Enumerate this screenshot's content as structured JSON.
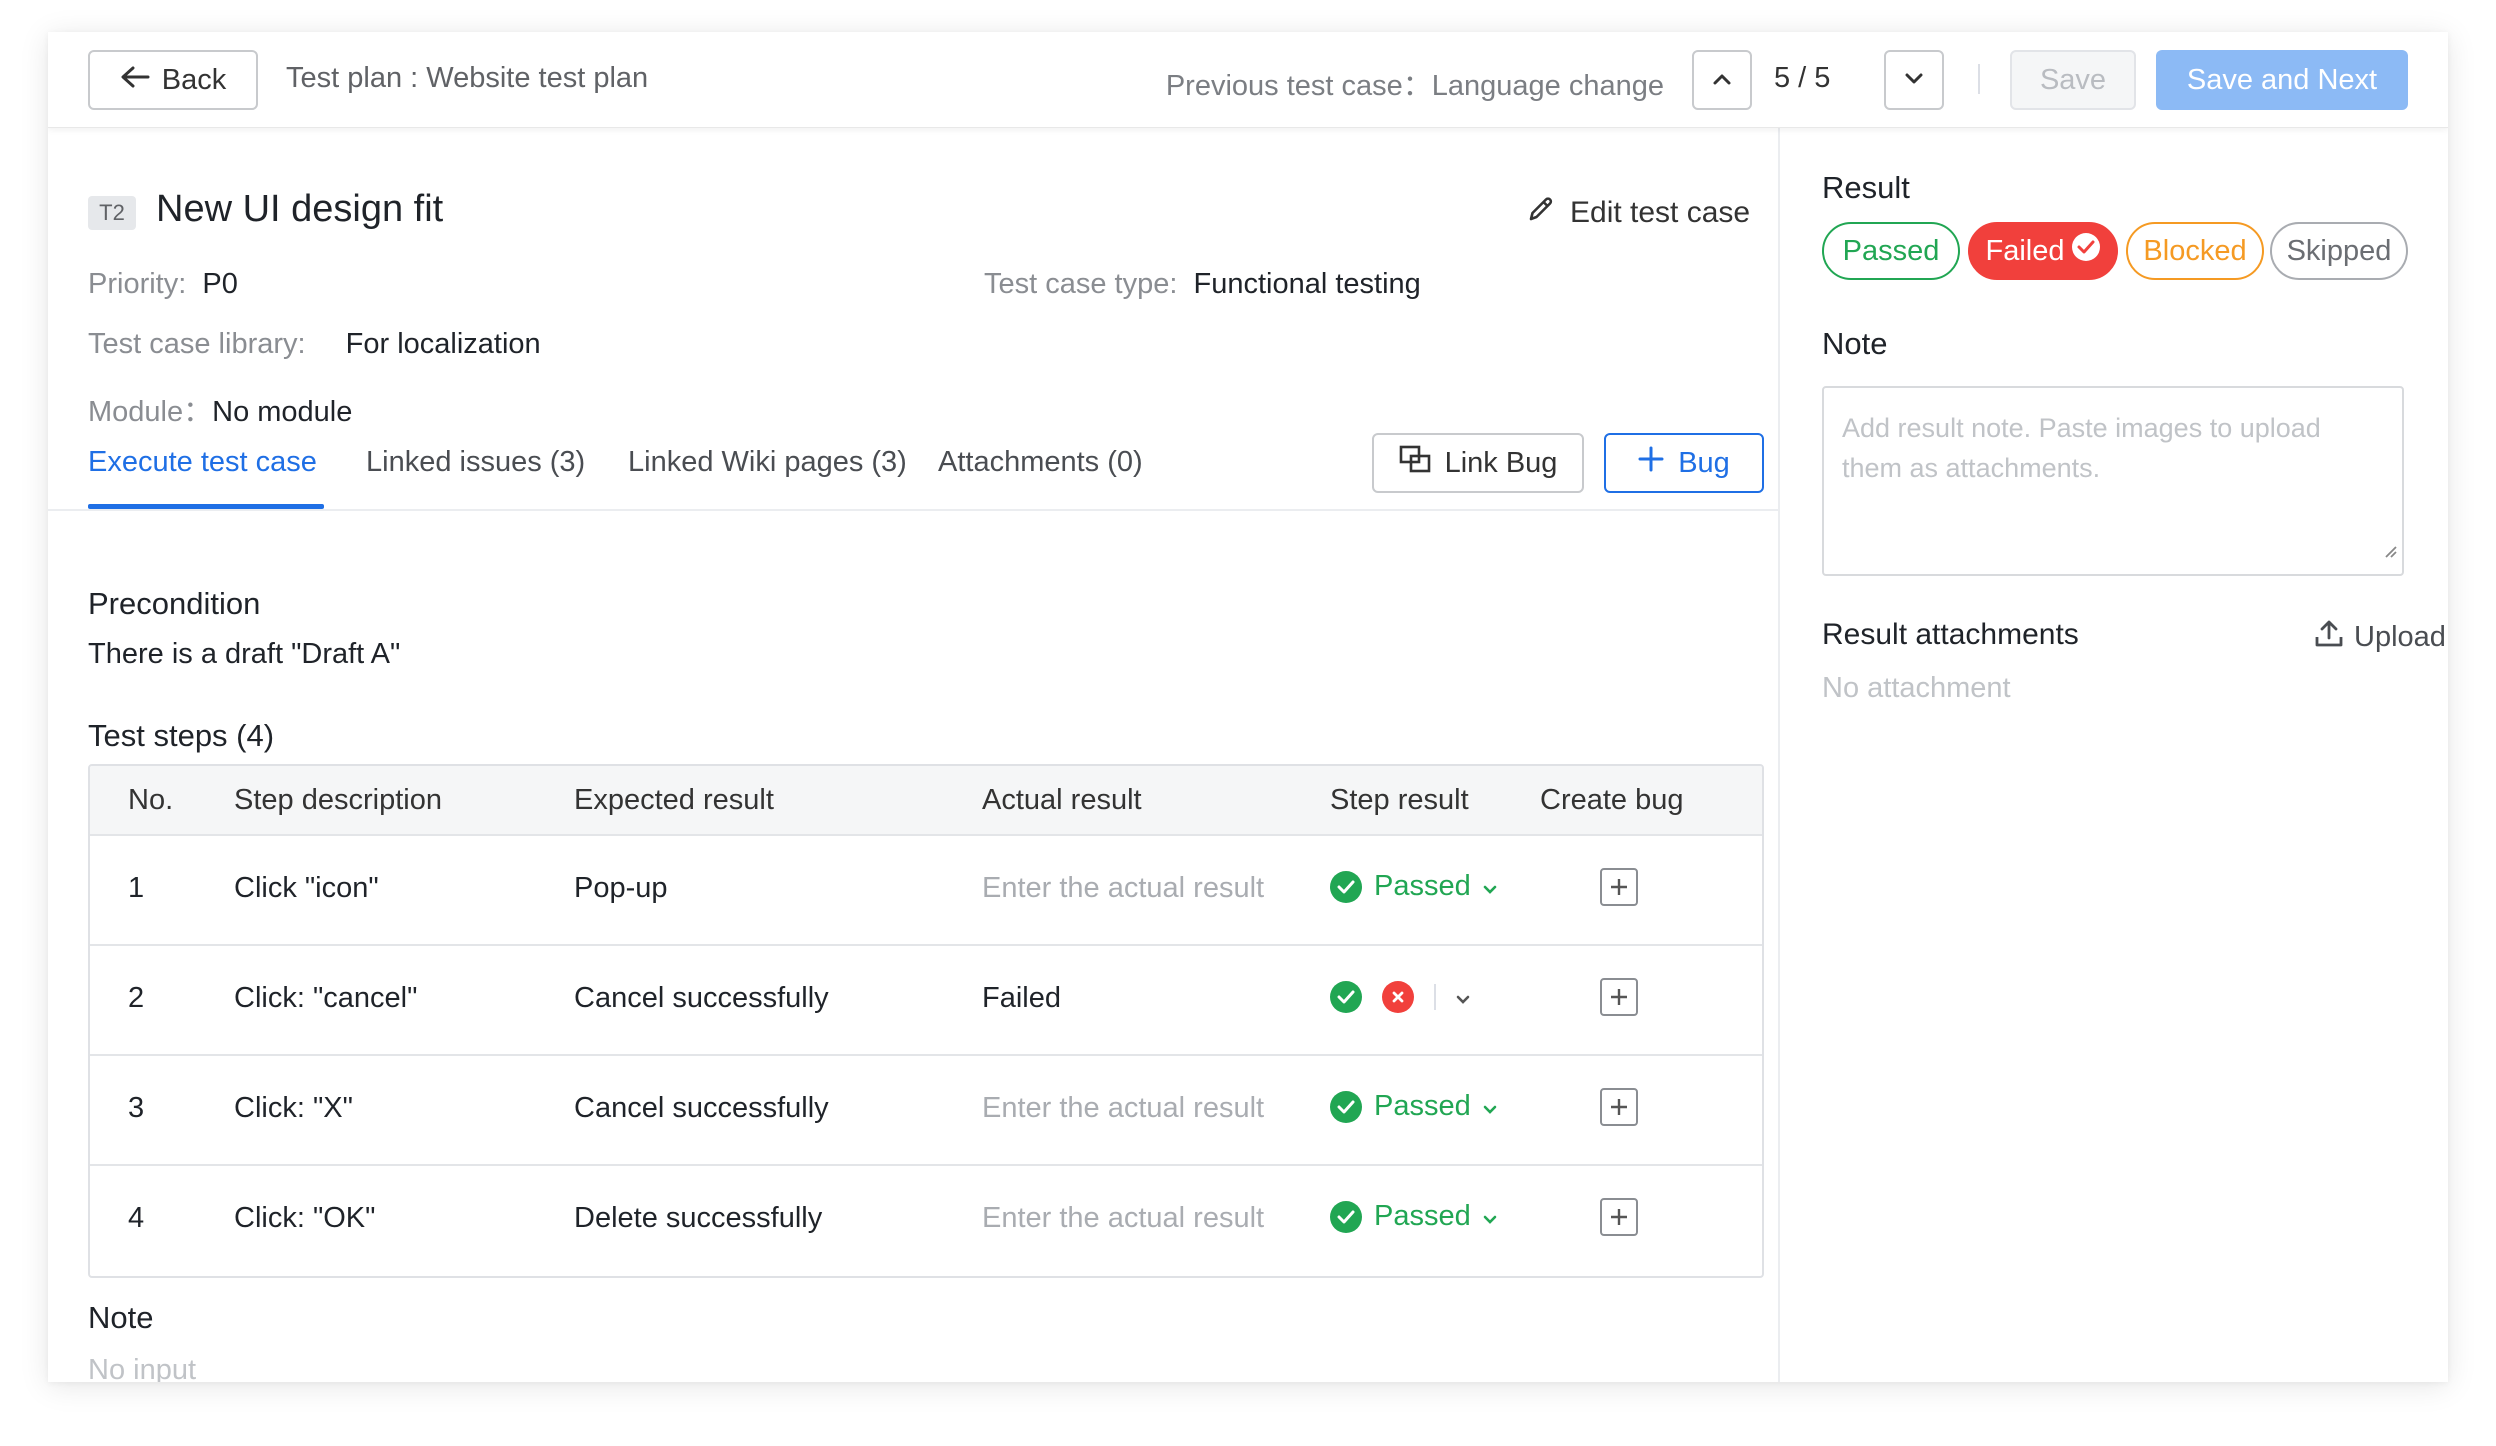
{
  "header": {
    "back_label": "Back",
    "plan_title": "Test plan : Website test plan",
    "previous_case": "Previous test case：Language change",
    "counter": "5 / 5",
    "save_label": "Save",
    "save_next_label": "Save and Next"
  },
  "case": {
    "badge": "T2",
    "title": "New UI design fit",
    "edit_label": "Edit test case",
    "priority_label": "Priority:",
    "priority_value": "P0",
    "type_label": "Test case type:",
    "type_value": "Functional testing",
    "library_label": "Test case library:",
    "library_value": "For localization",
    "module_label": "Module：",
    "module_value": "No module"
  },
  "tabs": [
    {
      "label": "Execute test case",
      "active": true
    },
    {
      "label": "Linked issues (3)",
      "active": false
    },
    {
      "label": "Linked Wiki pages (3)",
      "active": false
    },
    {
      "label": "Attachments (0)",
      "active": false
    }
  ],
  "actions": {
    "link_bug_label": "Link Bug",
    "bug_label": "Bug"
  },
  "precondition": {
    "title": "Precondition",
    "text": "There is a draft \"Draft A\""
  },
  "steps": {
    "title": "Test steps (4)",
    "columns": [
      "No.",
      "Step description",
      "Expected result",
      "Actual result",
      "Step result",
      "Create bug"
    ],
    "rows": [
      {
        "no": "1",
        "description": "Click \"icon\"",
        "expected": "Pop-up",
        "actual": "Enter the actual result",
        "actual_is_placeholder": true,
        "result": "Passed",
        "result_mode": "passed"
      },
      {
        "no": "2",
        "description": "Click: \"cancel\"",
        "expected": "Cancel successfully",
        "actual": "Failed",
        "actual_is_placeholder": false,
        "result": "",
        "result_mode": "choose"
      },
      {
        "no": "3",
        "description": "Click: \"X\"",
        "expected": "Cancel successfully",
        "actual": "Enter the actual result",
        "actual_is_placeholder": true,
        "result": "Passed",
        "result_mode": "passed"
      },
      {
        "no": "4",
        "description": "Click: \"OK\"",
        "expected": "Delete successfully",
        "actual": "Enter the actual result",
        "actual_is_placeholder": true,
        "result": "Passed",
        "result_mode": "passed"
      }
    ]
  },
  "note": {
    "title": "Note",
    "value": "No input"
  },
  "result_panel": {
    "title": "Result",
    "options": [
      {
        "label": "Passed",
        "color": "#21a653",
        "selected": false
      },
      {
        "label": "Failed",
        "color": "#f1403c",
        "selected": true
      },
      {
        "label": "Blocked",
        "color": "#f59a23",
        "selected": false
      },
      {
        "label": "Skipped",
        "color": "#8a8d92",
        "selected": false
      }
    ],
    "note_title": "Note",
    "note_placeholder": "Add result note. Paste images to upload them as attachments.",
    "attachments_title": "Result attachments",
    "upload_label": "Upload",
    "no_attachment": "No attachment"
  },
  "colors": {
    "primary": "#1f6fe5",
    "primary_light": "#8cbaf5",
    "success": "#21a653",
    "danger": "#f1403c",
    "warning": "#f59a23"
  }
}
